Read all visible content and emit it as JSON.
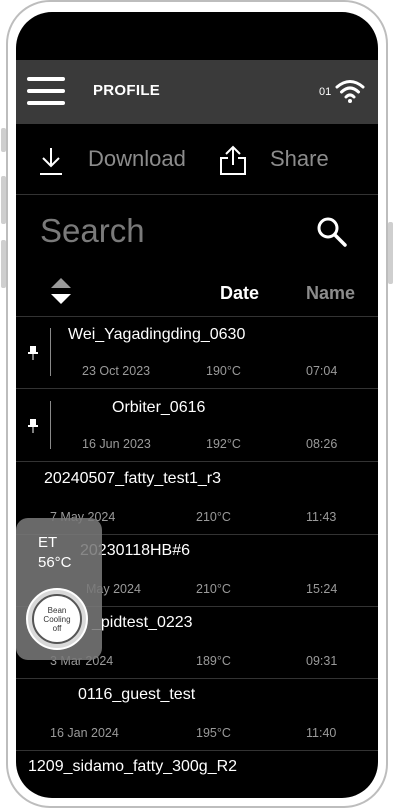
{
  "header": {
    "title": "PROFILE",
    "signal_number": "01"
  },
  "toolbar": {
    "download_label": "Download",
    "share_label": "Share"
  },
  "search": {
    "label": "Search"
  },
  "columns": {
    "date": "Date",
    "name": "Name"
  },
  "profiles": [
    {
      "name": "Wei_Yagadingding_0630",
      "date": "23 Oct 2023",
      "temp": "190°C",
      "duration": "07:04",
      "pinned": true
    },
    {
      "name": "Orbiter_0616",
      "date": "16 Jun 2023",
      "temp": "192°C",
      "duration": "08:26",
      "pinned": true
    },
    {
      "name": "20240507_fatty_test1_r3",
      "date": "7 May 2024",
      "temp": "210°C",
      "duration": "11:43",
      "pinned": false
    },
    {
      "name": "20230118HB#6",
      "date": "May 2024",
      "temp": "210°C",
      "duration": "15:24",
      "pinned": false
    },
    {
      "name": "_pidtest_0223",
      "date": "3 Mar 2024",
      "temp": "189°C",
      "duration": "09:31",
      "pinned": false
    },
    {
      "name": "0116_guest_test",
      "date": "16 Jan 2024",
      "temp": "195°C",
      "duration": "11:40",
      "pinned": false
    },
    {
      "name": "1209_sidamo_fatty_300g_R2",
      "date": "",
      "temp": "",
      "duration": "",
      "pinned": false
    }
  ],
  "et_panel": {
    "label": "ET",
    "value": "56°C",
    "button_line1": "Bean",
    "button_line2": "Cooling",
    "button_line3": "off"
  },
  "colors": {
    "background": "#000000",
    "topbar": "#3a3a3a",
    "muted_text": "#8c8c8c"
  }
}
